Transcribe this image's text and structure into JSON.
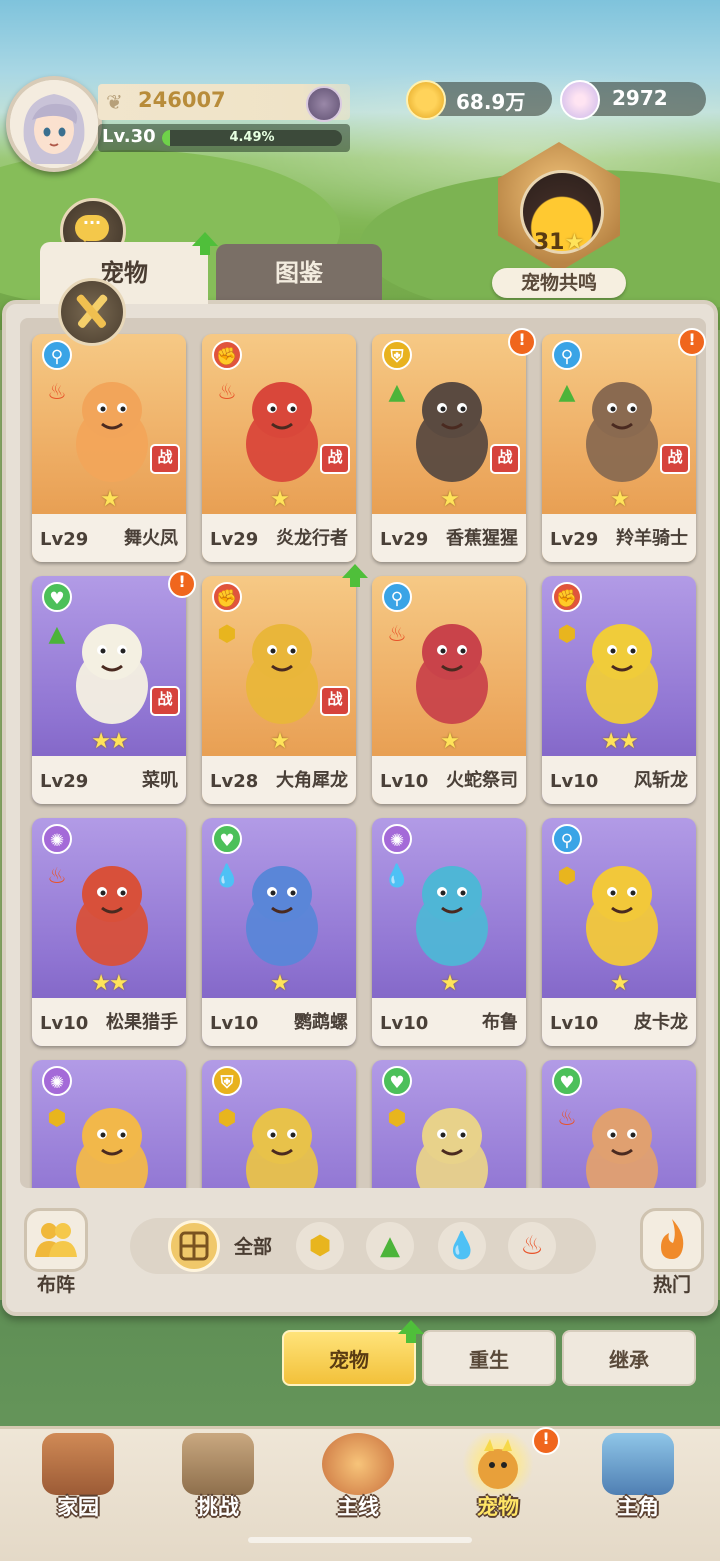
{
  "player": {
    "score": "246007",
    "level": "Lv.30",
    "xp_percent": "4.49%",
    "xp_fraction": 0.0449
  },
  "currencies": [
    {
      "icon": "gold-coin-icon",
      "value": "68.9万"
    },
    {
      "icon": "shell-gem-icon",
      "value": "2972"
    }
  ],
  "resonance": {
    "count": "31",
    "label": "宠物共鸣"
  },
  "tabs": [
    {
      "label": "宠物",
      "active": true
    },
    {
      "label": "图鉴",
      "active": false
    }
  ],
  "pets": [
    {
      "level": "Lv29",
      "name": "舞火凤",
      "stars": "★",
      "rarity": "gold",
      "type": "agility",
      "elements": [
        "fire"
      ],
      "battle": "战",
      "alert": false
    },
    {
      "level": "Lv29",
      "name": "炎龙行者",
      "stars": "★",
      "rarity": "gold",
      "type": "power",
      "elements": [
        "fire"
      ],
      "battle": "战",
      "alert": false
    },
    {
      "level": "Lv29",
      "name": "香蕉猩猩",
      "stars": "★",
      "rarity": "gold",
      "type": "defense",
      "elements": [
        "grass"
      ],
      "battle": "战",
      "alert": true
    },
    {
      "level": "Lv29",
      "name": "羚羊骑士",
      "stars": "★",
      "rarity": "gold",
      "type": "agility",
      "elements": [
        "grass"
      ],
      "battle": "战",
      "alert": true
    },
    {
      "level": "Lv29",
      "name": "菜叽",
      "stars": "★★",
      "rarity": "purple",
      "type": "heal",
      "elements": [
        "grass"
      ],
      "battle": "战",
      "alert": true
    },
    {
      "level": "Lv28",
      "name": "大角犀龙",
      "stars": "★",
      "rarity": "gold",
      "type": "power",
      "elements": [
        "earth"
      ],
      "battle": "战",
      "alert": false
    },
    {
      "level": "Lv10",
      "name": "火蛇祭司",
      "stars": "★",
      "rarity": "gold",
      "type": "agility",
      "elements": [
        "fire"
      ],
      "battle": "",
      "alert": false
    },
    {
      "level": "Lv10",
      "name": "风斩龙",
      "stars": "★★",
      "rarity": "purple",
      "type": "power",
      "elements": [
        "earth"
      ],
      "battle": "",
      "alert": false
    },
    {
      "level": "Lv10",
      "name": "松果猎手",
      "stars": "★★",
      "rarity": "purple",
      "type": "magic",
      "elements": [
        "fire"
      ],
      "battle": "",
      "alert": false
    },
    {
      "level": "Lv10",
      "name": "鹦鹉螺",
      "stars": "★",
      "rarity": "purple",
      "type": "heal",
      "elements": [
        "water"
      ],
      "battle": "",
      "alert": false
    },
    {
      "level": "Lv10",
      "name": "布鲁",
      "stars": "★",
      "rarity": "purple",
      "type": "magic",
      "elements": [
        "water"
      ],
      "battle": "",
      "alert": false
    },
    {
      "level": "Lv10",
      "name": "皮卡龙",
      "stars": "★",
      "rarity": "purple",
      "type": "agility",
      "elements": [
        "earth"
      ],
      "battle": "",
      "alert": false
    },
    {
      "level": "",
      "name": "",
      "stars": "",
      "rarity": "purple",
      "type": "magic",
      "elements": [
        "earth"
      ],
      "battle": "",
      "alert": false
    },
    {
      "level": "",
      "name": "",
      "stars": "",
      "rarity": "purple",
      "type": "defense",
      "elements": [
        "earth"
      ],
      "battle": "",
      "alert": false
    },
    {
      "level": "",
      "name": "",
      "stars": "",
      "rarity": "purple",
      "type": "heal",
      "elements": [
        "earth"
      ],
      "battle": "",
      "alert": false
    },
    {
      "level": "",
      "name": "",
      "stars": "",
      "rarity": "purple",
      "type": "heal",
      "elements": [
        "fire"
      ],
      "battle": "",
      "alert": false
    }
  ],
  "filters": {
    "all_label": "全部",
    "chips": [
      "earth-element-icon",
      "grass-element-icon",
      "water-element-icon",
      "fire-element-icon"
    ]
  },
  "side_buttons": {
    "formation": "布阵",
    "popular": "热门"
  },
  "actions": [
    {
      "label": "宠物",
      "active": true
    },
    {
      "label": "重生",
      "active": false
    },
    {
      "label": "继承",
      "active": false
    }
  ],
  "nav": [
    {
      "label": "家园",
      "icon": "meat-house-icon",
      "active": false
    },
    {
      "label": "挑战",
      "icon": "challenge-board-icon",
      "active": false
    },
    {
      "label": "主线",
      "icon": "sun-emblem-icon",
      "active": false
    },
    {
      "label": "宠物",
      "icon": "pet-dragon-icon",
      "active": true
    },
    {
      "label": "主角",
      "icon": "castle-icon",
      "active": false
    }
  ],
  "colors": {
    "gold_card": "#eca85e",
    "purple_card": "#8f74d2",
    "alert": "#f0661d",
    "battle": "#d6433c",
    "xp": "#6fd14a"
  }
}
